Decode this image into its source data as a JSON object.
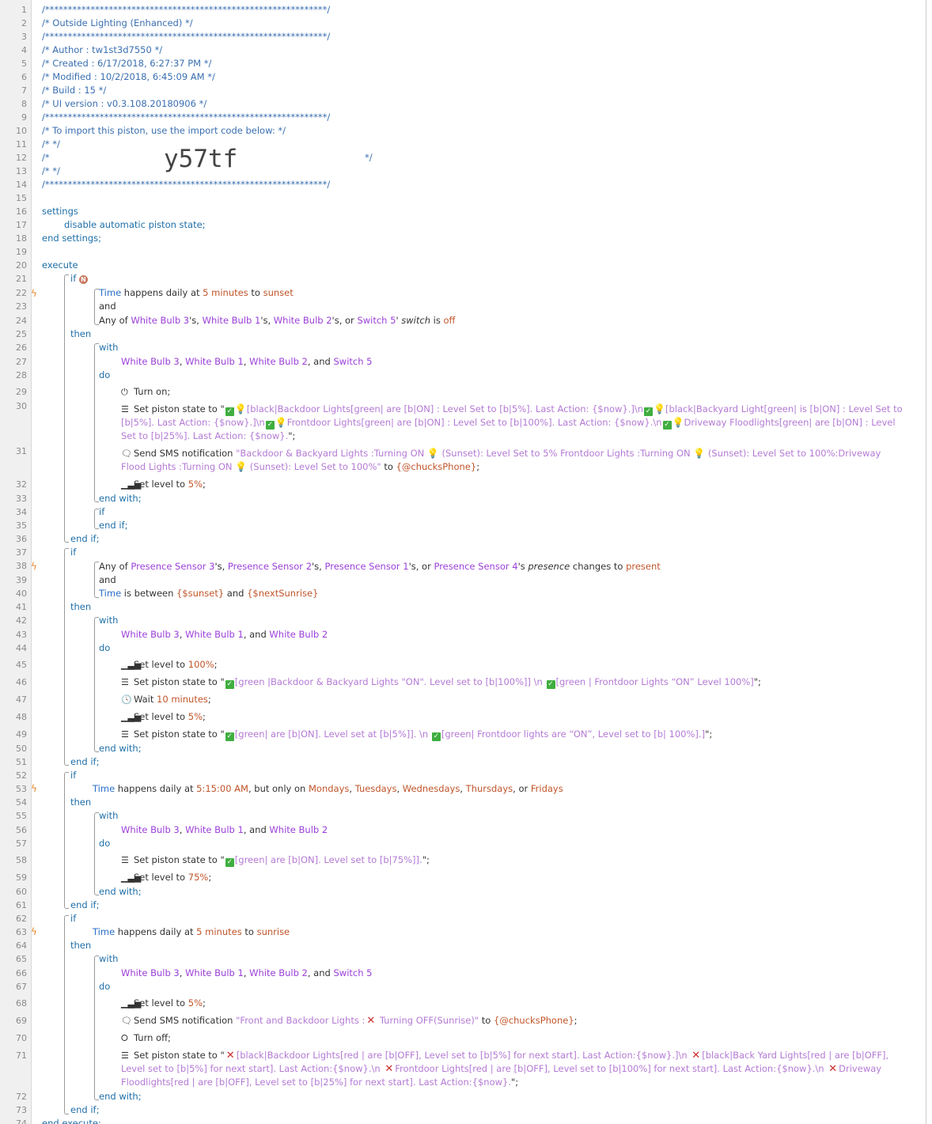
{
  "piston": {
    "header": {
      "stars": "/**************************************************************/",
      "title": "/* Outside Lighting (Enhanced)                                 */",
      "author": "/* Author     : tw1st3d7550                                    */",
      "created": "/* Created    : 6/17/2018, 6:27:37 PM                          */",
      "modified": "/* Modified   : 10/2/2018, 6:45:09 AM                          */",
      "build": "/* Build      : 15                                           */",
      "ui_version": "/* UI version : v0.3.108.20180906                             */",
      "import_note": "/* To import this piston, use the import code below:          */",
      "blank": "/*                                                            */",
      "import_code_left": "/*",
      "import_code": "y57tf",
      "import_code_right": "*/"
    },
    "keywords": {
      "settings": "settings",
      "end_settings": "end settings;",
      "execute": "execute",
      "end_execute": "end execute;",
      "if": "if",
      "then": "then",
      "end_if": "end if;",
      "with": "with",
      "do": "do",
      "end_with": "end with;",
      "and": "and"
    },
    "settings": {
      "disable": "disable automatic piston state;"
    },
    "if1": {
      "badge": "N",
      "cond1": {
        "subject": "Time",
        "t1": " happens daily at ",
        "v1": "5",
        "t2": " ",
        "v2": "minutes",
        "t3": " to ",
        "v3": "sunset"
      },
      "cond2": {
        "p0": "Any of ",
        "d1": "White Bulb 3",
        "p1": "'s, ",
        "d2": "White Bulb 1",
        "p2": "'s, ",
        "d3": "White Bulb 2",
        "p3": "'s, or ",
        "d4": "Switch 5",
        "p4": "' ",
        "attr": "switch",
        "p5": " is ",
        "val": "off"
      },
      "devices": {
        "d1": "White Bulb 3",
        "s1": ", ",
        "d2": "White Bulb 1",
        "s2": ", ",
        "d3": "White Bulb 2",
        "s3": ", and ",
        "d4": "Switch 5"
      },
      "turn_on": "Turn on;",
      "state": {
        "t0": "Set piston state to \"",
        "t1": "[black|Backdoor Lights[green| are [b|ON] : Level Set to [b|5%]. Last Action: {$now}.]\\n",
        "t2": "[black|Backyard Light[green| is [b|ON] : Level Set to [b|5%]. Last Action: {$now}.]\\n",
        "t3": "Frontdoor Lights[green| are [b|ON] : Level Set to [b|100%]. Last Action: {$now}.\\n",
        "t4": "Driveway Floodlights[green| are [b|ON] : Level Set to [b|25%]. Last Action: {$now}.",
        "t5": "\";"
      },
      "sms": {
        "t0": "Send SMS notification ",
        "q1": "\"Backdoor & Backyard Lights :Turning ON ",
        "q2": " (Sunset): Level Set to 5% Frontdoor Lights :Turning ON ",
        "q3": " (Sunset): Level Set to 100%:Driveway Flood Lights :Turning ON ",
        "q4": " (Sunset): Level Set to 100%\"",
        "to": " to ",
        "phone": "{@chucksPhone}",
        "end": ";"
      },
      "level": {
        "t0": "Set level to ",
        "v": "5%",
        "end": ";"
      }
    },
    "if2": {
      "cond1": {
        "p0": "Any of ",
        "d1": "Presence Sensor 3",
        "p1": "'s, ",
        "d2": "Presence Sensor 2",
        "p2": "'s, ",
        "d3": "Presence Sensor 1",
        "p3": "'s, or ",
        "d4": "Presence Sensor 4",
        "p4": "'s ",
        "attr": "presence",
        "p5": " changes to ",
        "val": "present"
      },
      "cond2": {
        "subject": "Time",
        "t1": " is between ",
        "v1": "{$sunset}",
        "t2": " and ",
        "v2": "{$nextSunrise}"
      },
      "devices": {
        "d1": "White Bulb 3",
        "s1": ", ",
        "d2": "White Bulb 1",
        "s2": ", and ",
        "d3": "White Bulb 2"
      },
      "level100": {
        "t0": "Set level to ",
        "v": "100%",
        "end": ";"
      },
      "state1": {
        "t0": "Set piston state to \"",
        "t1": "[green |Backdoor & Backyard Lights \"ON\". Level set to [b|100%]] \\n ",
        "t2": "[green | Frontdoor Lights “ON” Level 100%]",
        "t3": "\";"
      },
      "wait": {
        "t0": "Wait ",
        "v1": "10",
        "t1": " ",
        "v2": "minutes",
        "end": ";"
      },
      "level5": {
        "t0": "Set level to ",
        "v": "5%",
        "end": ";"
      },
      "state2": {
        "t0": "Set piston state to \"",
        "t1": "[green| are [b|ON]. Level set at [b|5%]]. \\n ",
        "t2": "[green| Frontdoor lights are “ON”, Level set to [b| 100%].]",
        "t3": "\";"
      }
    },
    "if3": {
      "cond1": {
        "subject": "Time",
        "t1": " happens daily at ",
        "v1": "5:15:00 AM",
        "t2": ", but only on ",
        "v2": "Mondays",
        "s1": ", ",
        "v3": "Tuesdays",
        "s2": ", ",
        "v4": "Wednesdays",
        "s3": ", ",
        "v5": "Thursdays",
        "s4": ", or ",
        "v6": "Fridays"
      },
      "devices": {
        "d1": "White Bulb 3",
        "s1": ", ",
        "d2": "White Bulb 1",
        "s2": ", and ",
        "d3": "White Bulb 2"
      },
      "state": {
        "t0": "Set piston state to \"",
        "t1": "[green| are [b|ON]. Level set to [b|75%]].",
        "t2": "\";"
      },
      "level": {
        "t0": "Set level to ",
        "v": "75%",
        "end": ";"
      }
    },
    "if4": {
      "cond1": {
        "subject": "Time",
        "t1": " happens daily at ",
        "v1": "5",
        "t2": " ",
        "v2": "minutes",
        "t3": " to ",
        "v3": "sunrise"
      },
      "devices": {
        "d1": "White Bulb 3",
        "s1": ", ",
        "d2": "White Bulb 1",
        "s2": ", ",
        "d3": "White Bulb 2",
        "s3": ", and ",
        "d4": "Switch 5"
      },
      "level": {
        "t0": "Set level to ",
        "v": "5%",
        "end": ";"
      },
      "sms": {
        "t0": "Send SMS notification ",
        "q1": "\"Front and Backdoor Lights :",
        "q2": " Turning OFF(Sunrise)\"",
        "to": " to ",
        "phone": "{@chucksPhone}",
        "end": ";"
      },
      "turn_off": "Turn off;",
      "state": {
        "t0": "Set piston state to \"",
        "t1": "[black|Backdoor Lights[red | are [b|OFF], Level set to [b|5%] for next start]. Last Action:{$now}.]\\n ",
        "t2": "[black|Back Yard Lights[red | are [b|OFF], Level set to [b|5%] for next start]. Last Action:{$now}.\\n ",
        "t3": "Frontdoor Lights[red | are [b|OFF], Level set to [b|100%] for next start]. Last Action:{$now}.\\n ",
        "t4": "Driveway Floodlights[red | are [b|OFF], Level set to [b|25%] for next start]. Last Action:{$now}.",
        "t5": "\";"
      }
    }
  }
}
